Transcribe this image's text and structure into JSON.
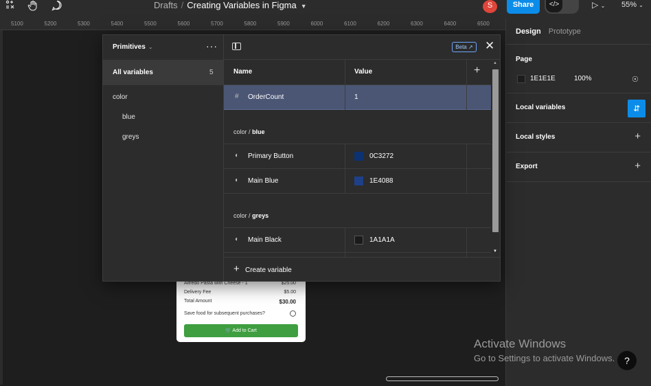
{
  "toolbar": {
    "breadcrumb_root": "Drafts",
    "breadcrumb_sep": "/",
    "file_name": "Creating Variables in Figma",
    "avatar_initial": "S",
    "share_label": "Share",
    "zoom": "55%"
  },
  "ruler": {
    "labels": [
      "5100",
      "5200",
      "5300",
      "5400",
      "5500",
      "5600",
      "5700",
      "5800",
      "5900",
      "6000",
      "6100",
      "6200",
      "6300",
      "6400",
      "6500"
    ]
  },
  "variables_modal": {
    "collection_name": "Primitives",
    "all_variables_label": "All variables",
    "all_variables_count": "5",
    "groups": [
      {
        "label": "color"
      },
      {
        "label": "blue"
      },
      {
        "label": "greys"
      }
    ],
    "beta_label": "Beta",
    "columns": {
      "name": "Name",
      "value": "Value"
    },
    "rows": [
      {
        "name": "OrderCount",
        "value": "1"
      }
    ],
    "blue_group": {
      "prefix": "color",
      "sep": "/",
      "name": "blue",
      "rows": [
        {
          "name": "Primary Button",
          "hex": "0C3272",
          "color": "#0C3272"
        },
        {
          "name": "Main Blue",
          "hex": "1E4088",
          "color": "#1E4088"
        }
      ]
    },
    "greys_group": {
      "prefix": "color",
      "sep": "/",
      "name": "greys",
      "rows": [
        {
          "name": "Main Black",
          "hex": "1A1A1A",
          "color": "#1A1A1A"
        }
      ]
    },
    "create_variable_label": "Create variable"
  },
  "right_panel": {
    "tab_design": "Design",
    "tab_prototype": "Prototype",
    "page_label": "Page",
    "page_color": "1E1E1E",
    "page_opacity": "100%",
    "local_variables_label": "Local variables",
    "local_styles_label": "Local styles",
    "export_label": "Export"
  },
  "canvas_frame": {
    "item_label": "Alfredo Pasta with Cheese - 1",
    "item_price": "$25.00",
    "delivery_label": "Delivery Fee",
    "delivery_price": "$5.00",
    "total_label": "Total Amount",
    "total_price": "$30.00",
    "save_label": "Save food for subsequent purchases?",
    "add_to_cart_label": "Add to Cart"
  },
  "os_watermark": {
    "title": "Activate Windows",
    "subtitle": "Go to Settings to activate Windows."
  },
  "help_label": "?"
}
